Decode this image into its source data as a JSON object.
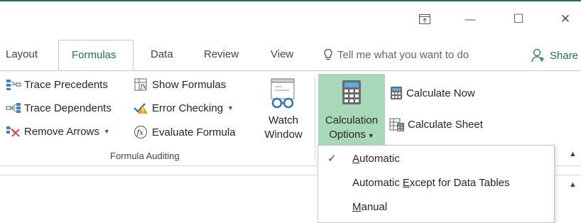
{
  "window": {
    "minimize": "—",
    "maximize": "☐",
    "close": "✕"
  },
  "tabs": [
    {
      "label": "Layout"
    },
    {
      "label": "Formulas",
      "active": true
    },
    {
      "label": "Data"
    },
    {
      "label": "Review"
    },
    {
      "label": "View"
    }
  ],
  "tell_me": {
    "text": "Tell me what you want to do",
    "icon": "lightbulb-icon"
  },
  "share": {
    "label": "Share",
    "icon": "person-add-icon"
  },
  "formula_auditing": {
    "group_label": "Formula Auditing",
    "trace_precedents": "Trace Precedents",
    "trace_dependents": "Trace Dependents",
    "remove_arrows": "Remove Arrows",
    "show_formulas": "Show Formulas",
    "error_checking": "Error Checking",
    "evaluate_formula": "Evaluate Formula",
    "watch_window_line1": "Watch",
    "watch_window_line2": "Window"
  },
  "calculation": {
    "options_line1": "Calculation",
    "options_line2": "Options",
    "calculate_now": "Calculate Now",
    "calculate_sheet": "Calculate Sheet"
  },
  "dropdown": {
    "items": [
      {
        "prefix": "",
        "accel": "A",
        "rest": "utomatic",
        "checked": true
      },
      {
        "prefix": "Automatic ",
        "accel": "E",
        "rest": "xcept for Data Tables",
        "checked": false
      },
      {
        "prefix": "",
        "accel": "M",
        "rest": "anual",
        "checked": false
      }
    ],
    "checkmark": "✓"
  },
  "colors": {
    "accent": "#217346",
    "calc_highlight": "#a9d8b8"
  }
}
